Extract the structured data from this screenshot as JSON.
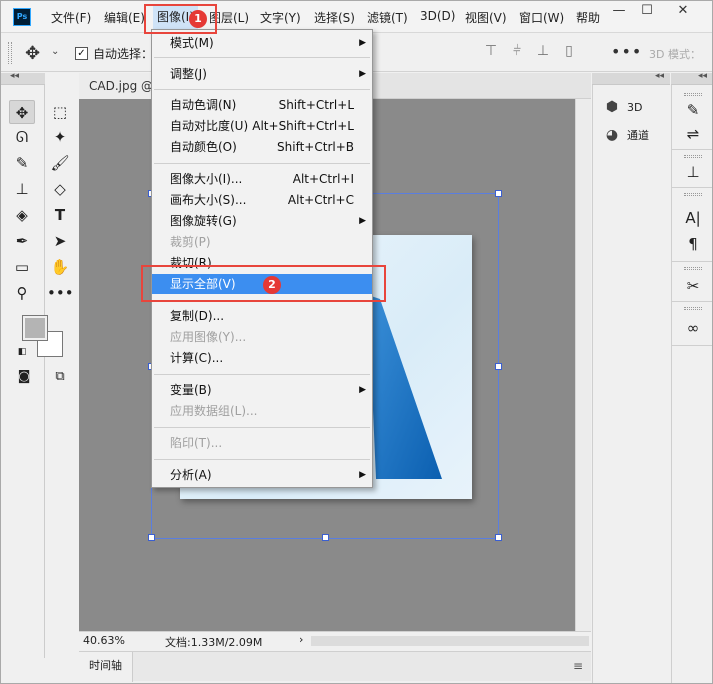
{
  "menubar": {
    "logo": "Ps",
    "items": [
      "文件(F)",
      "编辑(E)",
      "图像(I)",
      "图层(L)",
      "文字(Y)",
      "选择(S)",
      "滤镜(T)",
      "3D(D)",
      "视图(V)",
      "窗口(W)",
      "帮助"
    ],
    "active_item": "图像(I)"
  },
  "window_controls": {
    "minimize": "—",
    "maximize": "☐",
    "close": "✕"
  },
  "options_bar": {
    "auto_select_label": "自动选择：",
    "auto_select_checked": "✓",
    "mode_3d": "3D 模式："
  },
  "doc_tab": {
    "title": "CAD.jpg @"
  },
  "status": {
    "zoom": "40.63%",
    "doc_info": "文档:1.33M/2.09M",
    "arrow": "›"
  },
  "timeline": {
    "tab": "时间轴"
  },
  "right_panel": {
    "item_3d": "3D",
    "item_channels": "通道"
  },
  "image_menu": {
    "items": [
      {
        "label": "模式(M)",
        "shortcut": "",
        "submenu": true,
        "disabled": false
      },
      {
        "label": "调整(J)",
        "shortcut": "",
        "submenu": true,
        "disabled": false
      },
      {
        "label": "自动色调(N)",
        "shortcut": "Shift+Ctrl+L",
        "submenu": false,
        "disabled": false
      },
      {
        "label": "自动对比度(U)",
        "shortcut": "Alt+Shift+Ctrl+L",
        "submenu": false,
        "disabled": false
      },
      {
        "label": "自动颜色(O)",
        "shortcut": "Shift+Ctrl+B",
        "submenu": false,
        "disabled": false
      },
      {
        "label": "图像大小(I)...",
        "shortcut": "Alt+Ctrl+I",
        "submenu": false,
        "disabled": false
      },
      {
        "label": "画布大小(S)...",
        "shortcut": "Alt+Ctrl+C",
        "submenu": false,
        "disabled": false
      },
      {
        "label": "图像旋转(G)",
        "shortcut": "",
        "submenu": true,
        "disabled": false
      },
      {
        "label": "裁剪(P)",
        "shortcut": "",
        "submenu": false,
        "disabled": true
      },
      {
        "label": "裁切(R)...",
        "shortcut": "",
        "submenu": false,
        "disabled": false
      },
      {
        "label": "显示全部(V)",
        "shortcut": "",
        "submenu": false,
        "disabled": false
      },
      {
        "label": "复制(D)...",
        "shortcut": "",
        "submenu": false,
        "disabled": false
      },
      {
        "label": "应用图像(Y)...",
        "shortcut": "",
        "submenu": false,
        "disabled": true
      },
      {
        "label": "计算(C)...",
        "shortcut": "",
        "submenu": false,
        "disabled": false
      },
      {
        "label": "变量(B)",
        "shortcut": "",
        "submenu": true,
        "disabled": false
      },
      {
        "label": "应用数据组(L)...",
        "shortcut": "",
        "submenu": false,
        "disabled": true
      },
      {
        "label": "陷印(T)...",
        "shortcut": "",
        "submenu": false,
        "disabled": true
      },
      {
        "label": "分析(A)",
        "shortcut": "",
        "submenu": true,
        "disabled": false
      }
    ],
    "highlighted": "显示全部(V)"
  },
  "annotations": {
    "step1": "1",
    "step2": "2"
  },
  "colors": {
    "highlight": "#3c8ef0",
    "annotation": "#e8453c",
    "canvas_bg": "#8a8a8a"
  }
}
